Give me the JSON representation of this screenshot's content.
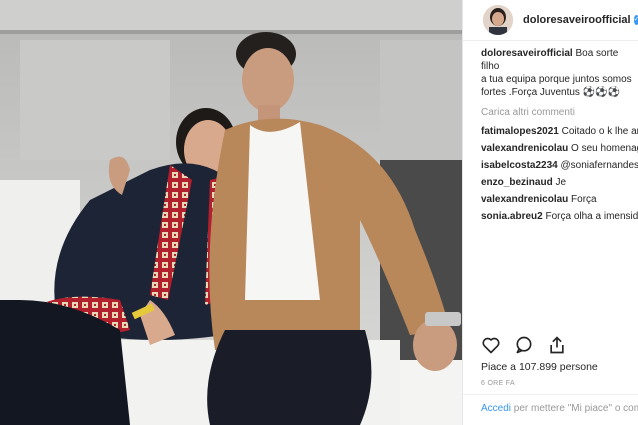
{
  "post": {
    "username": "doloresaveiroofficial",
    "verified_icon": "verified-badge-icon",
    "caption_user": "doloresaveirofficial",
    "caption_text": "Boa sorte filho\na tua equipa porque juntos somos\nfortes .Força Juventus ⚽⚽⚽",
    "load_more": "Carica altri commenti",
    "comments": [
      {
        "user": "fatimalopes2021",
        "text": "Coitado o k lhe\narranjar ▯mta sorte 💋💋"
      },
      {
        "user": "valexandrenicolau",
        "text": "O seu homenagem"
      },
      {
        "user": "isabelcosta2234",
        "text": "@soniafernandes\nconcordo.... Lutador, sensível, não\nmerecia.... Mas, os famosos são\nperceguidos...!!!! Está numa fase não\nboa, mas , vai passar.... Calam a boca\nvaquita,... Com dinheiro!!!! Tanto\nadvogado a mamar, milhões...!!!! Ai\ndum gozo à 9 anos!!!! 😂😂😂😂▯▯▯▯"
      },
      {
        "user": "enzo_bezinaud",
        "text": "Je"
      },
      {
        "user": "valexandrenicolau",
        "text": "Força"
      },
      {
        "user": "sonia.abreu2",
        "text": "Força olha a imensidão"
      }
    ],
    "actions": [
      "heart-icon",
      "comment-icon",
      "share-icon"
    ],
    "likes": "Piace a 107.899 persone",
    "time": "6 ORE FA",
    "login_link": "Accedi",
    "login_text": " per mettere \"Mi piace\" o\ncommentare."
  },
  "colors": {
    "link": "#3897f0",
    "muted": "#999999",
    "text": "#262626"
  }
}
